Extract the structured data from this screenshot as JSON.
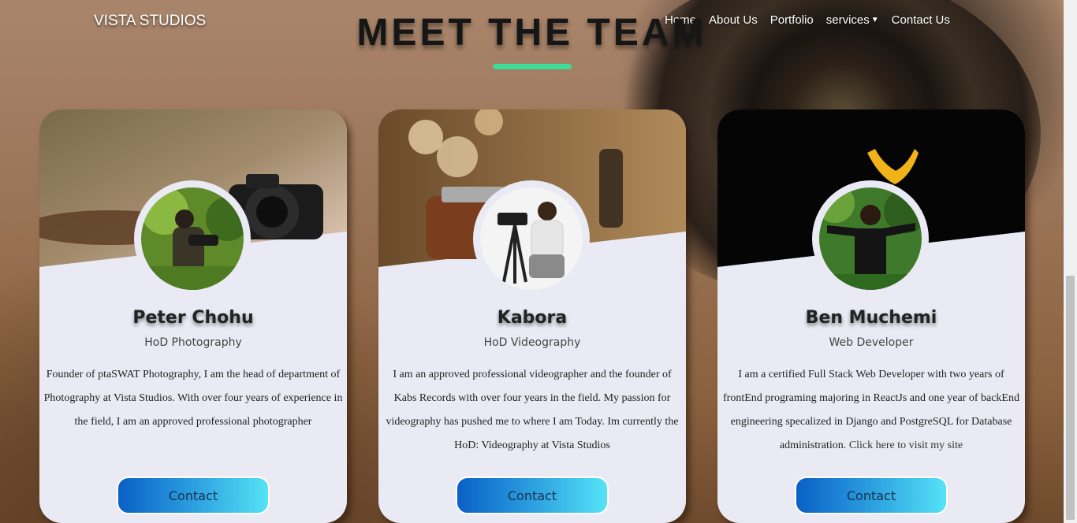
{
  "navbar": {
    "brand": "VISTA STUDIOS",
    "links": [
      {
        "label": "Home"
      },
      {
        "label": "About Us"
      },
      {
        "label": "Portfolio"
      },
      {
        "label": "services"
      },
      {
        "label": "Contact Us"
      }
    ]
  },
  "hero": {
    "title": "MEET THE TEAM",
    "accent_color": "#3ddc97"
  },
  "team": [
    {
      "name": "Peter Chohu",
      "role": "HoD Photography",
      "bio": "Founder of ptaSWAT Photography, I am the head of department of Photography at Vista Studios. With over four years of experience in the field, I am an approved professional photographer",
      "button": "Contact"
    },
    {
      "name": "Kabora",
      "role": "HoD Videography",
      "bio": "I am an approved professional videographer and the founder of Kabs Records with over four years in the field. My passion for videography has pushed me to where I am Today. Im currently the HoD: Videography at Vista Studios",
      "button": "Contact"
    },
    {
      "name": "Ben Muchemi",
      "role": "Web Developer",
      "bio": "I am a certified Full Stack Web Developer with two years of frontEnd programing majoring in ReactJs and one year of backEnd engineering specalized in Django and PostgreSQL for Database administration.",
      "bio_link": "Click here to visit my site",
      "button": "Contact"
    }
  ],
  "colors": {
    "card_bg": "#eaeaf5",
    "button_gradient_start": "#0a60c6",
    "button_gradient_end": "#55e3f6"
  }
}
